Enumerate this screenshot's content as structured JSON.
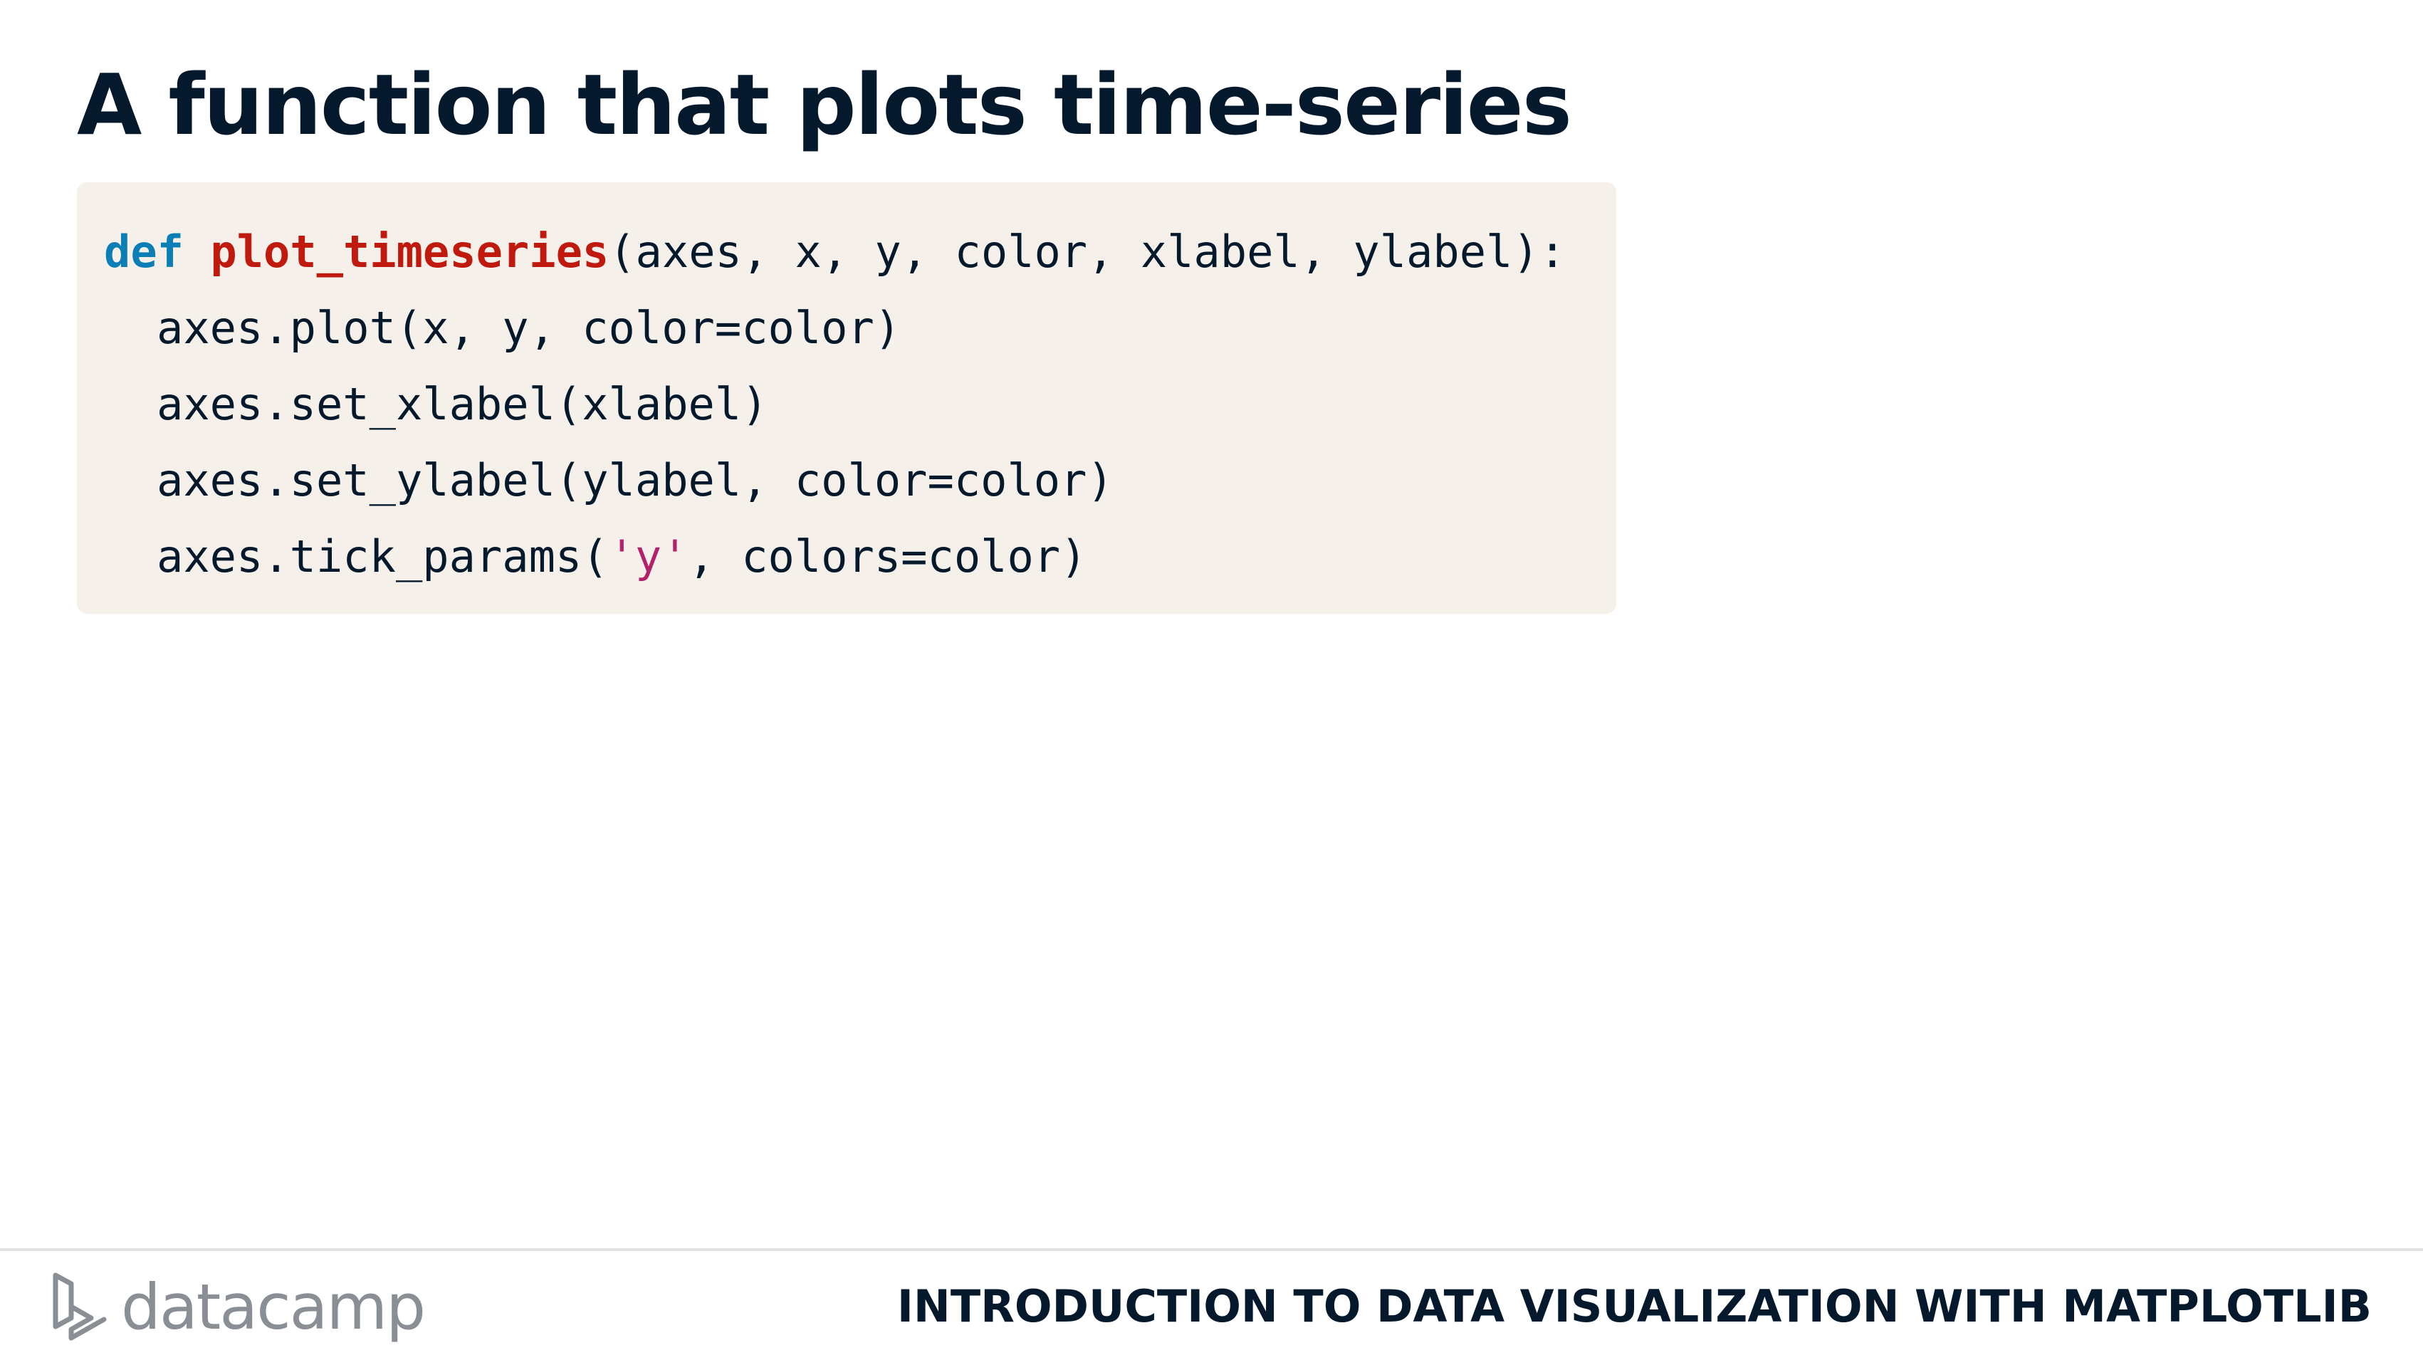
{
  "slide": {
    "title": "A function that plots time-series"
  },
  "code": {
    "line1": {
      "keyword": "def",
      "space": " ",
      "function_name": "plot_timeseries",
      "params": "(axes, x, y, color, xlabel, ylabel):"
    },
    "line2": "axes.plot(x, y, color=color)",
    "line3": "axes.set_xlabel(xlabel)",
    "line4": "axes.set_ylabel(ylabel, color=color)",
    "line5": {
      "prefix": "axes.tick_params(",
      "string": "'y'",
      "suffix": ", colors=color)"
    }
  },
  "footer": {
    "logo_text": "datacamp",
    "course_title": "INTRODUCTION TO DATA VISUALIZATION WITH MATPLOTLIB"
  },
  "colors": {
    "title": "#05192d",
    "code_background": "#f5f1ea",
    "keyword": "#0b7fb5",
    "function_name": "#c01a0f",
    "string": "#b3216a",
    "logo": "#8a8f96"
  },
  "icons": {
    "logo": "datacamp-logo-icon"
  }
}
